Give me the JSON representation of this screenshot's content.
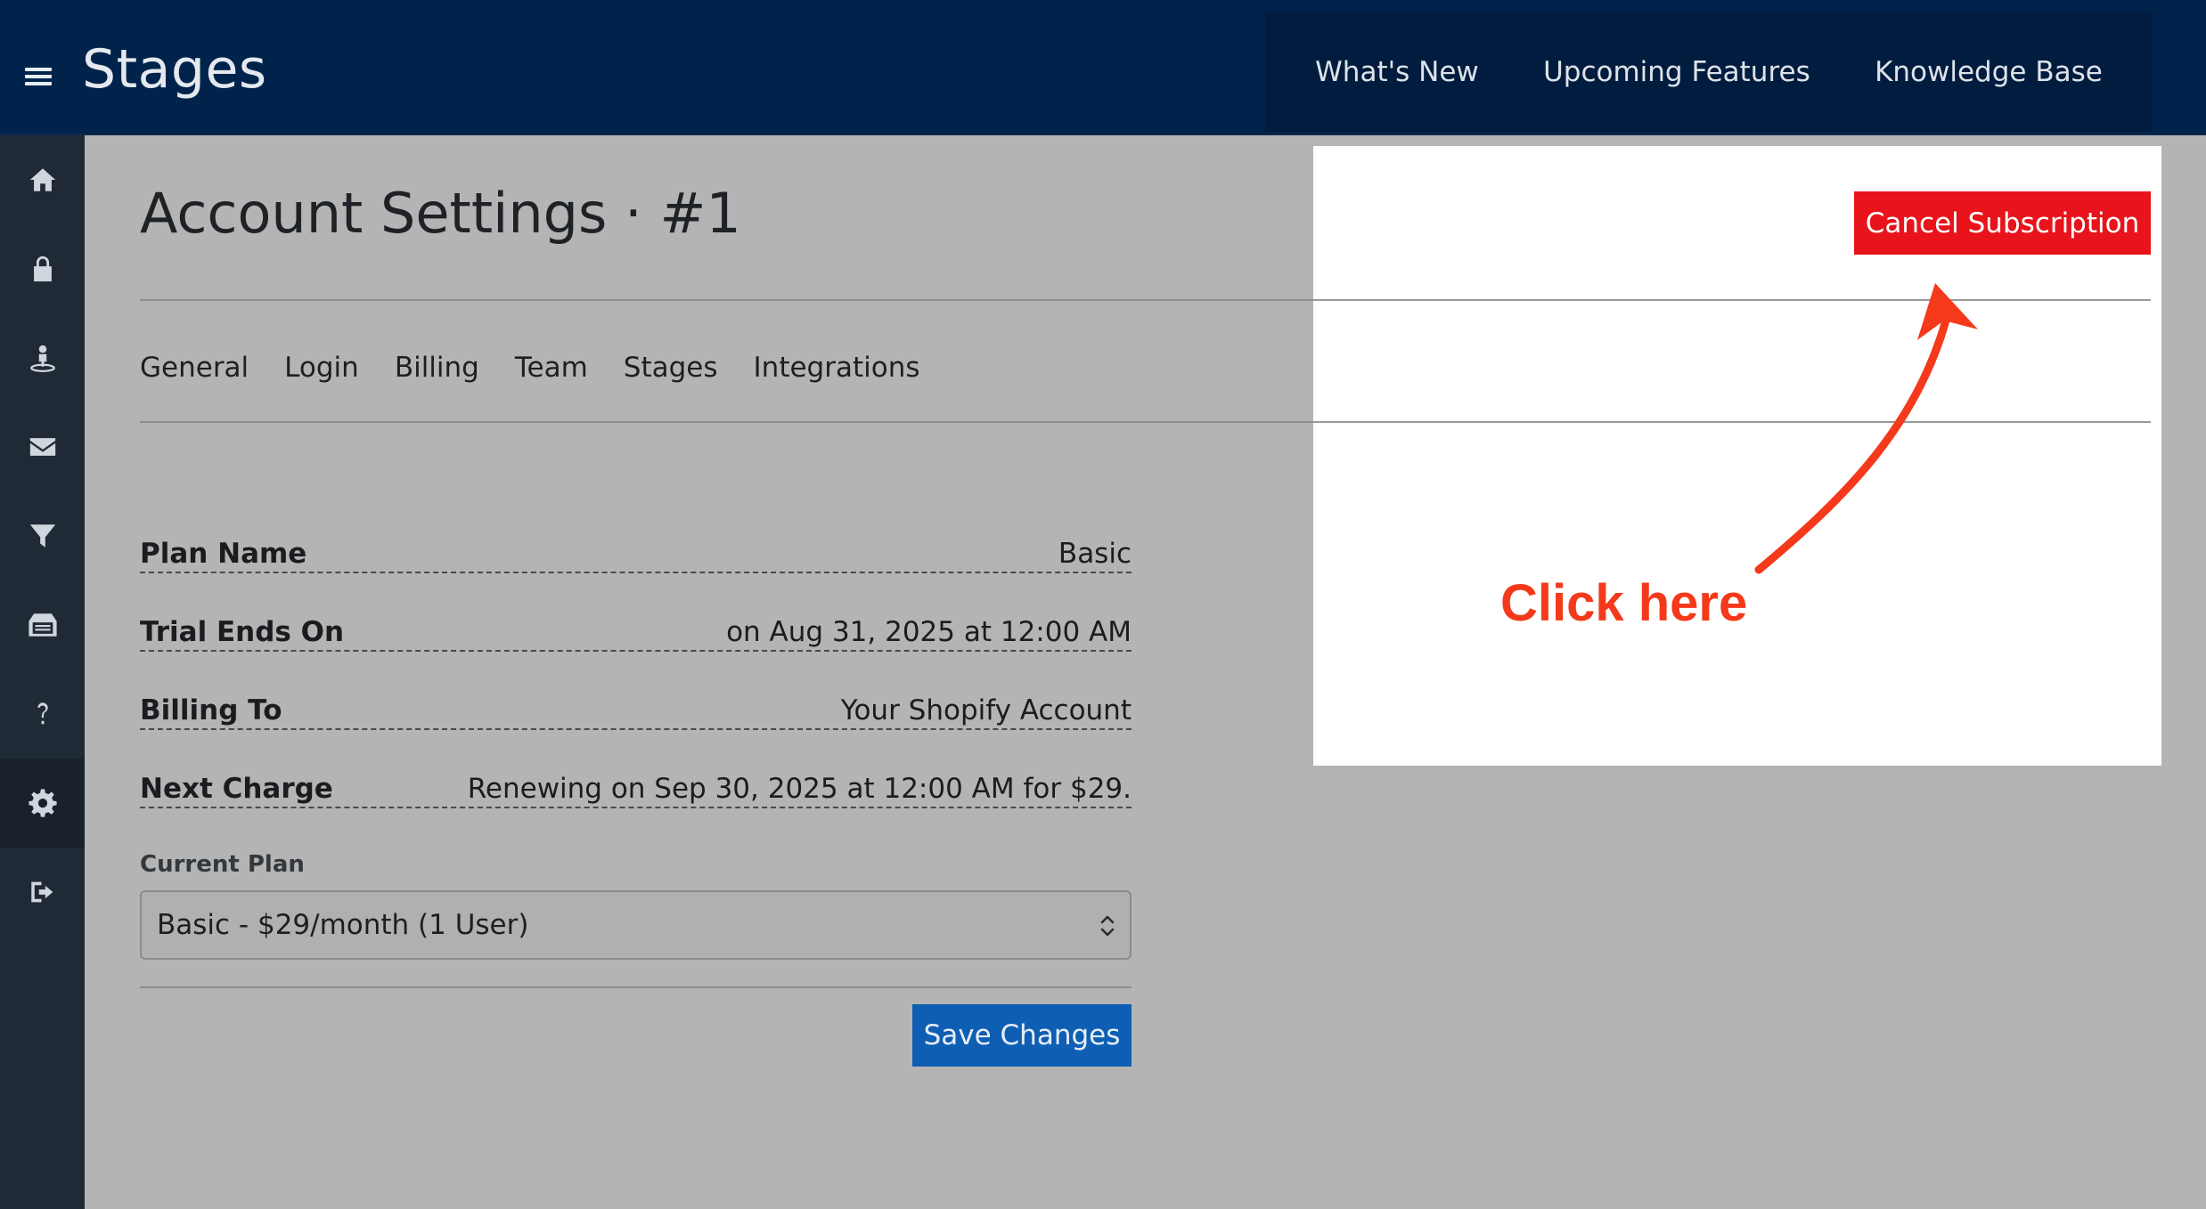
{
  "app": {
    "title": "Stages"
  },
  "topnav": {
    "items": [
      "What's New",
      "Upcoming Features",
      "Knowledge Base"
    ]
  },
  "sidebar": {
    "items": [
      {
        "icon": "home-icon"
      },
      {
        "icon": "lock-icon"
      },
      {
        "icon": "user-pin-icon"
      },
      {
        "icon": "envelope-icon"
      },
      {
        "icon": "filter-icon"
      },
      {
        "icon": "inbox-icon"
      },
      {
        "icon": "question-icon"
      },
      {
        "icon": "gear-icon",
        "active": true
      },
      {
        "icon": "sign-out-icon"
      }
    ]
  },
  "page": {
    "title": "Account Settings · #1"
  },
  "tabs": [
    "General",
    "Login",
    "Billing",
    "Team",
    "Stages",
    "Integrations"
  ],
  "billing": {
    "rows": [
      {
        "label": "Plan Name",
        "value": "Basic"
      },
      {
        "label": "Trial Ends On",
        "value": "on Aug 31, 2025 at 12:00 AM"
      },
      {
        "label": "Billing To",
        "value": "Your Shopify Account"
      },
      {
        "label": "Next Charge",
        "value": "Renewing on Sep 30, 2025 at 12:00 AM for $29."
      }
    ],
    "current_plan_label": "Current Plan",
    "current_plan_value": "Basic - $29/month (1 User)",
    "save_label": "Save Changes"
  },
  "highlight": {
    "cancel_label": "Cancel Subscription",
    "annotation": "Click here"
  },
  "colors": {
    "header": "#00234b",
    "sidebar": "#1f2a36",
    "save_button": "#0e5fb3",
    "cancel_button": "#e8131b",
    "annotation": "#f5391b"
  }
}
